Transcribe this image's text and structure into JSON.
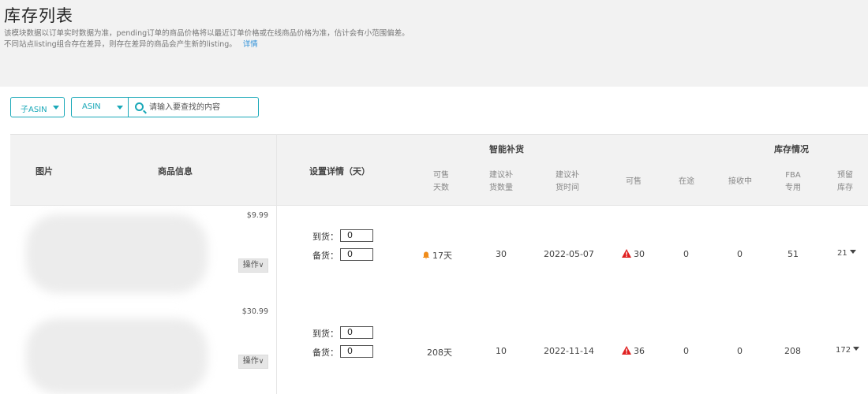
{
  "header": {
    "title": "库存列表",
    "desc_line1": "该模块数据以订单实时数据为准，pending订单的商品价格将以最近订单价格或在线商品价格为准，估计会有小范围偏差。",
    "desc_line2": "不同站点listing组合存在差异，则存在差异的商品会产生新的listing。",
    "detail_link": "详情"
  },
  "filters": {
    "select1": "子ASIN",
    "select2": "ASIN",
    "search_placeholder": "请输入要查找的内容"
  },
  "table_head": {
    "col_image": "图片",
    "col_product": "商品信息",
    "col_settings": "设置详情（天）",
    "group_smart": "智能补货",
    "group_stock": "库存情况",
    "sub": {
      "sellable_days": "可售\n天数",
      "suggest_qty": "建议补\n货数量",
      "suggest_time": "建议补\n货时间",
      "sellable": "可售",
      "in_transit": "在途",
      "receiving": "接收中",
      "fba": "FBA\n专用",
      "reserved": "预留\n库存"
    }
  },
  "settings_labels": {
    "arrival": "到货：",
    "stock": "备货："
  },
  "rows": [
    {
      "price": "$9.99",
      "op": "操作",
      "arrival": "0",
      "stock": "0",
      "sellable_days": "17天",
      "suggest_qty": "30",
      "suggest_time": "2022-05-07",
      "sellable": "30",
      "in_transit": "0",
      "receiving": "0",
      "fba": "51",
      "reserved": "21"
    },
    {
      "price": "$30.99",
      "op": "操作",
      "arrival": "0",
      "stock": "0",
      "sellable_days": "208天",
      "suggest_qty": "10",
      "suggest_time": "2022-11-14",
      "sellable": "36",
      "in_transit": "0",
      "receiving": "0",
      "fba": "208",
      "reserved": "172"
    }
  ],
  "colors": {
    "accent": "#19a8b8",
    "link": "#2b8fd8",
    "warn": "#e02020",
    "bell": "#f08c1a"
  }
}
